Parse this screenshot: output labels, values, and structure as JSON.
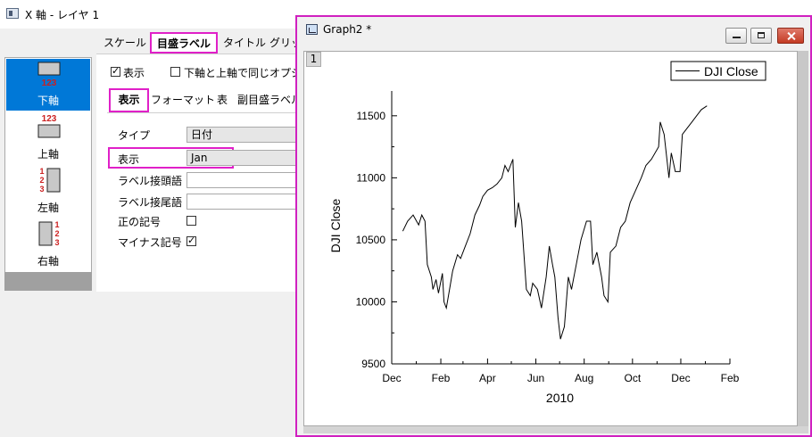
{
  "axis_dialog": {
    "title": "X 軸 - レイヤ 1",
    "axes": [
      {
        "label": "下軸",
        "numbers": "123"
      },
      {
        "label": "上軸",
        "numbers": "123"
      },
      {
        "label": "左軸",
        "numbers": "123"
      },
      {
        "label": "右軸",
        "numbers": "123"
      }
    ],
    "tabs": [
      "スケール",
      "目盛ラベル",
      "タイトル",
      "グリッ"
    ],
    "show_label": "表示",
    "same_option_label": "下軸と上軸で同じオプショ",
    "subtabs": [
      "表示",
      "フォーマット",
      "表",
      "副目盛ラベル"
    ],
    "rows": {
      "type_label": "タイプ",
      "type_value": "日付",
      "display_label": "表示",
      "display_value": "Jan",
      "prefix_label": "ラベル接頭語",
      "suffix_label": "ラベル接尾語",
      "plus_sign_label": "正の記号",
      "minus_sign_label": "マイナス記号"
    },
    "checks": {
      "show": true,
      "same_option": false,
      "plus_sign": false,
      "minus_sign": true
    }
  },
  "graph_window": {
    "title": "Graph2 *",
    "layer_number": "1"
  },
  "chart_data": {
    "type": "line",
    "title": "",
    "xlabel": "2010",
    "ylabel": "DJI Close",
    "x_ticks": [
      "Dec",
      "Feb",
      "Apr",
      "Jun",
      "Aug",
      "Oct",
      "Dec",
      "Feb"
    ],
    "y_ticks": [
      9500,
      10000,
      10500,
      11000,
      11500
    ],
    "ylim": [
      9500,
      11700
    ],
    "xlim": [
      "2009-12-01",
      "2011-02-01"
    ],
    "legend": "top-right",
    "grid": false,
    "series": [
      {
        "name": "DJI Close",
        "color": "#000000",
        "points": [
          [
            "2009-12-15",
            10570
          ],
          [
            "2009-12-21",
            10650
          ],
          [
            "2009-12-28",
            10700
          ],
          [
            "2010-01-04",
            10620
          ],
          [
            "2010-01-08",
            10700
          ],
          [
            "2010-01-12",
            10650
          ],
          [
            "2010-01-15",
            10300
          ],
          [
            "2010-01-20",
            10200
          ],
          [
            "2010-01-22",
            10100
          ],
          [
            "2010-01-26",
            10180
          ],
          [
            "2010-01-29",
            10070
          ],
          [
            "2010-02-03",
            10230
          ],
          [
            "2010-02-05",
            10000
          ],
          [
            "2010-02-08",
            9950
          ],
          [
            "2010-02-12",
            10100
          ],
          [
            "2010-02-16",
            10250
          ],
          [
            "2010-02-22",
            10380
          ],
          [
            "2010-02-26",
            10350
          ],
          [
            "2010-03-04",
            10450
          ],
          [
            "2010-03-10",
            10550
          ],
          [
            "2010-03-16",
            10700
          ],
          [
            "2010-03-22",
            10780
          ],
          [
            "2010-03-26",
            10850
          ],
          [
            "2010-04-01",
            10900
          ],
          [
            "2010-04-07",
            10920
          ],
          [
            "2010-04-13",
            10950
          ],
          [
            "2010-04-19",
            11000
          ],
          [
            "2010-04-23",
            11100
          ],
          [
            "2010-04-27",
            11050
          ],
          [
            "2010-05-03",
            11150
          ],
          [
            "2010-05-06",
            10600
          ],
          [
            "2010-05-10",
            10800
          ],
          [
            "2010-05-14",
            10650
          ],
          [
            "2010-05-20",
            10100
          ],
          [
            "2010-05-25",
            10050
          ],
          [
            "2010-05-28",
            10150
          ],
          [
            "2010-06-03",
            10100
          ],
          [
            "2010-06-08",
            9950
          ],
          [
            "2010-06-14",
            10200
          ],
          [
            "2010-06-18",
            10450
          ],
          [
            "2010-06-22",
            10300
          ],
          [
            "2010-06-25",
            10200
          ],
          [
            "2010-06-29",
            9870
          ],
          [
            "2010-07-02",
            9700
          ],
          [
            "2010-07-07",
            9800
          ],
          [
            "2010-07-12",
            10200
          ],
          [
            "2010-07-16",
            10100
          ],
          [
            "2010-07-22",
            10300
          ],
          [
            "2010-07-28",
            10500
          ],
          [
            "2010-08-04",
            10650
          ],
          [
            "2010-08-09",
            10650
          ],
          [
            "2010-08-12",
            10300
          ],
          [
            "2010-08-17",
            10400
          ],
          [
            "2010-08-23",
            10200
          ],
          [
            "2010-08-26",
            10050
          ],
          [
            "2010-08-31",
            10000
          ],
          [
            "2010-09-03",
            10400
          ],
          [
            "2010-09-10",
            10450
          ],
          [
            "2010-09-16",
            10600
          ],
          [
            "2010-09-22",
            10650
          ],
          [
            "2010-09-28",
            10800
          ],
          [
            "2010-10-05",
            10900
          ],
          [
            "2010-10-12",
            11000
          ],
          [
            "2010-10-18",
            11100
          ],
          [
            "2010-10-25",
            11150
          ],
          [
            "2010-11-03",
            11250
          ],
          [
            "2010-11-05",
            11450
          ],
          [
            "2010-11-10",
            11350
          ],
          [
            "2010-11-16",
            11000
          ],
          [
            "2010-11-19",
            11200
          ],
          [
            "2010-11-24",
            11050
          ],
          [
            "2010-11-30",
            11050
          ],
          [
            "2010-12-03",
            11350
          ],
          [
            "2010-12-09",
            11400
          ],
          [
            "2010-12-15",
            11450
          ],
          [
            "2010-12-21",
            11500
          ],
          [
            "2010-12-27",
            11550
          ],
          [
            "2011-01-03",
            11580
          ]
        ]
      }
    ]
  }
}
